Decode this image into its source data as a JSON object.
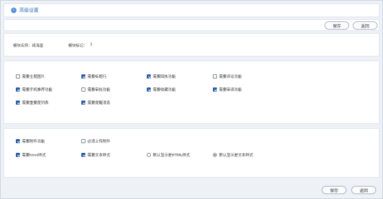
{
  "header": {
    "title": "高级设置",
    "icon": "circle-arrow-icon"
  },
  "toolbar_top": {
    "save_label": "保存",
    "back_label": "返回"
  },
  "toolbar_bottom": {
    "save_label": "保存",
    "back_label": "返回"
  },
  "module_info": {
    "name_label": "模块名称：",
    "name_value": "纸海星",
    "tag_label": "模块标记：",
    "tag_value": "1"
  },
  "features": [
    {
      "label": "需要主题图片",
      "checked": false
    },
    {
      "label": "需要标题行",
      "checked": true
    },
    {
      "label": "需要回执功能",
      "checked": true
    },
    {
      "label": "需要评论功能",
      "checked": false
    },
    {
      "label": "需要手机推荐功能",
      "checked": true
    },
    {
      "label": "需要审批功能",
      "checked": false
    },
    {
      "label": "需要收藏功能",
      "checked": true
    },
    {
      "label": "需要审读功能",
      "checked": true
    },
    {
      "label": "需要重要度列表",
      "checked": true
    },
    {
      "label": "需要提醒消息",
      "checked": true
    }
  ],
  "attachments": {
    "need_attachment": {
      "label": "需要附件功能",
      "checked": true
    },
    "must_upload": {
      "label": "必须上传附件",
      "checked": false
    },
    "need_html": {
      "label": "需要html样式",
      "checked": true
    },
    "need_text": {
      "label": "需要文本样式",
      "checked": true
    },
    "default_html": {
      "label": "默认显示是HTML样式",
      "selected": false
    },
    "default_text": {
      "label": "默认显示是文本样式",
      "selected": true
    }
  },
  "colors": {
    "accent": "#2a5ca8",
    "title": "#2f6bb5"
  }
}
